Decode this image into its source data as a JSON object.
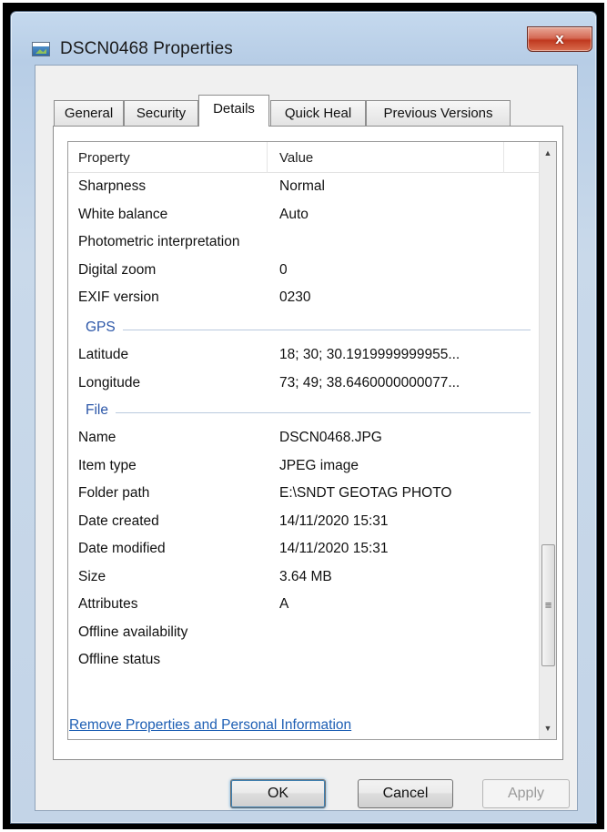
{
  "window": {
    "title": "DSCN0468 Properties",
    "close_label": "x"
  },
  "tabs": [
    {
      "label": "General"
    },
    {
      "label": "Security"
    },
    {
      "label": "Details",
      "active": true
    },
    {
      "label": "Quick Heal"
    },
    {
      "label": "Previous Versions"
    }
  ],
  "list": {
    "columns": {
      "property": "Property",
      "value": "Value"
    },
    "rows_top": [
      {
        "property": "Sharpness",
        "value": "Normal"
      },
      {
        "property": "White balance",
        "value": "Auto"
      },
      {
        "property": "Photometric interpretation",
        "value": ""
      },
      {
        "property": "Digital zoom",
        "value": "0"
      },
      {
        "property": "EXIF version",
        "value": "0230"
      }
    ],
    "group_gps": "GPS",
    "rows_gps": [
      {
        "property": "Latitude",
        "value": "18; 30; 30.1919999999955..."
      },
      {
        "property": "Longitude",
        "value": "73; 49; 38.6460000000077..."
      }
    ],
    "group_file": "File",
    "rows_file": [
      {
        "property": "Name",
        "value": "DSCN0468.JPG"
      },
      {
        "property": "Item type",
        "value": "JPEG image"
      },
      {
        "property": "Folder path",
        "value": "E:\\SNDT GEOTAG PHOTO"
      },
      {
        "property": "Date created",
        "value": "14/11/2020 15:31"
      },
      {
        "property": "Date modified",
        "value": "14/11/2020 15:31"
      },
      {
        "property": "Size",
        "value": "3.64 MB"
      },
      {
        "property": "Attributes",
        "value": "A"
      },
      {
        "property": "Offline availability",
        "value": ""
      },
      {
        "property": "Offline status",
        "value": ""
      }
    ]
  },
  "remove_link": "Remove Properties and Personal Information",
  "buttons": {
    "ok": "OK",
    "cancel": "Cancel",
    "apply": "Apply"
  },
  "icons": {
    "scroll_up": "up-arrow-icon",
    "scroll_down": "down-arrow-icon",
    "scroll_grip": "grip-icon",
    "window": "image-file-icon"
  }
}
